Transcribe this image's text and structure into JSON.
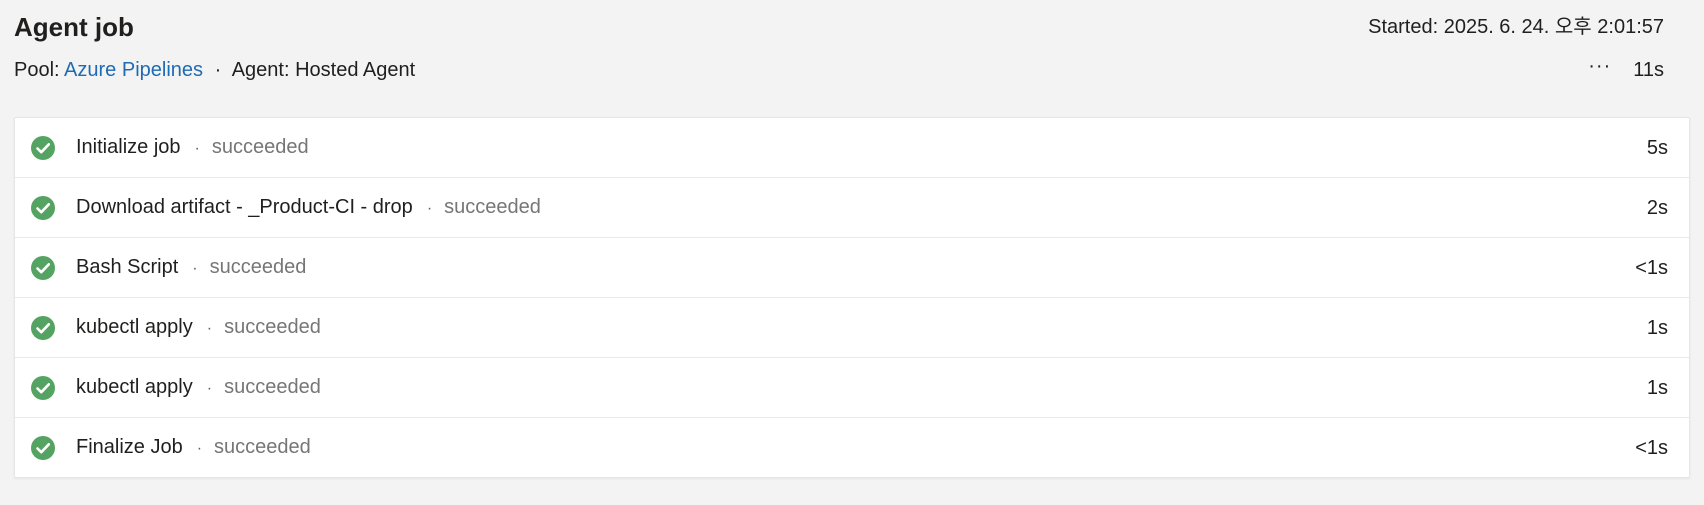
{
  "job": {
    "title": "Agent job",
    "started": "Started: 2025. 6. 24. 오후 2:01:57",
    "pool_label": "Pool:",
    "pool_name": "Azure Pipelines",
    "separator": "·",
    "agent_text": "Agent: Hosted Agent",
    "more_label": "···",
    "total_duration": "11s"
  },
  "colors": {
    "success": "#55a362",
    "link": "#1f6bb3"
  },
  "steps": [
    {
      "name": "Initialize job",
      "status": "succeeded",
      "duration": "5s",
      "icon": "check-circle-icon"
    },
    {
      "name": "Download artifact - _Product-CI - drop",
      "status": "succeeded",
      "duration": "2s",
      "icon": "check-circle-icon"
    },
    {
      "name": "Bash Script",
      "status": "succeeded",
      "duration": "<1s",
      "icon": "check-circle-icon"
    },
    {
      "name": "kubectl apply",
      "status": "succeeded",
      "duration": "1s",
      "icon": "check-circle-icon"
    },
    {
      "name": "kubectl apply",
      "status": "succeeded",
      "duration": "1s",
      "icon": "check-circle-icon"
    },
    {
      "name": "Finalize Job",
      "status": "succeeded",
      "duration": "<1s",
      "icon": "check-circle-icon"
    }
  ]
}
